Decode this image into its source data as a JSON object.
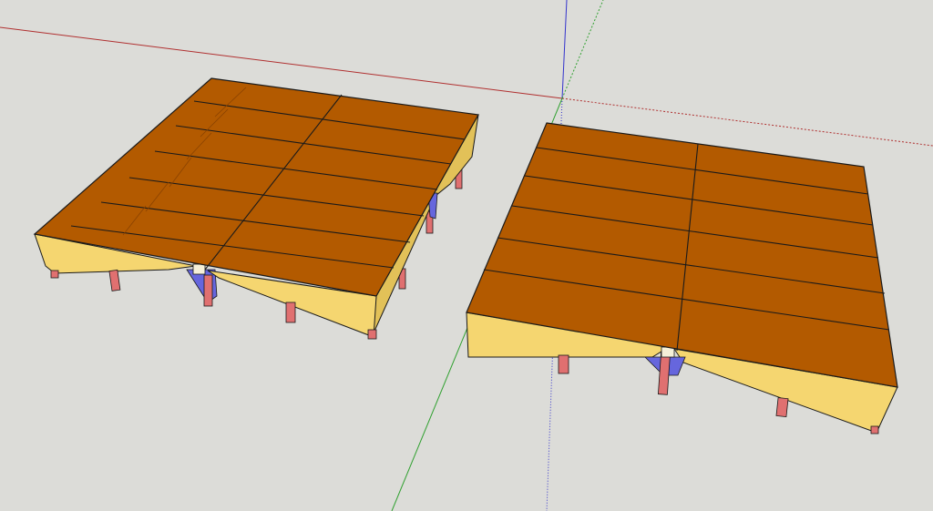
{
  "scene": {
    "background": "#dcdcd8",
    "axes": {
      "red": "#b03030",
      "green": "#2fa02f",
      "blue": "#3333cc"
    },
    "materials": {
      "deck_top": "#b35a00",
      "deck_edge": "#7a3c00",
      "fascia": "#f5d670",
      "fascia_shadow": "#e2c158",
      "leg": "#e07070",
      "brace": "#6666dd",
      "outline": "#1a1a1a"
    },
    "objects": [
      "left-deck-platform",
      "right-deck-platform"
    ]
  }
}
